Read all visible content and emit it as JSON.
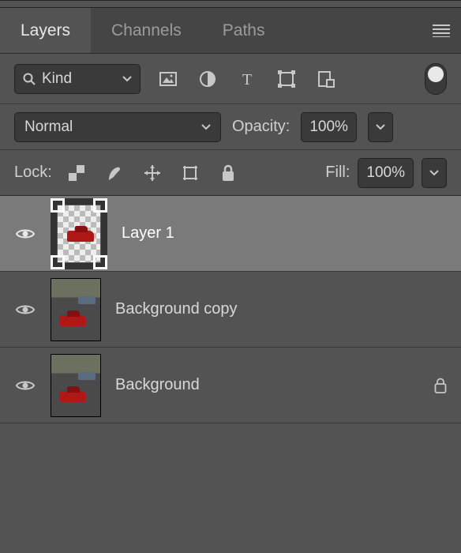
{
  "tabs": {
    "layers": "Layers",
    "channels": "Channels",
    "paths": "Paths"
  },
  "filter": {
    "kind_label": "Kind"
  },
  "blend": {
    "mode": "Normal",
    "opacity_label": "Opacity:",
    "opacity_value": "100%"
  },
  "lock": {
    "label": "Lock:",
    "fill_label": "Fill:",
    "fill_value": "100%"
  },
  "layers": [
    {
      "name": "Layer 1"
    },
    {
      "name": "Background copy"
    },
    {
      "name": "Background"
    }
  ]
}
